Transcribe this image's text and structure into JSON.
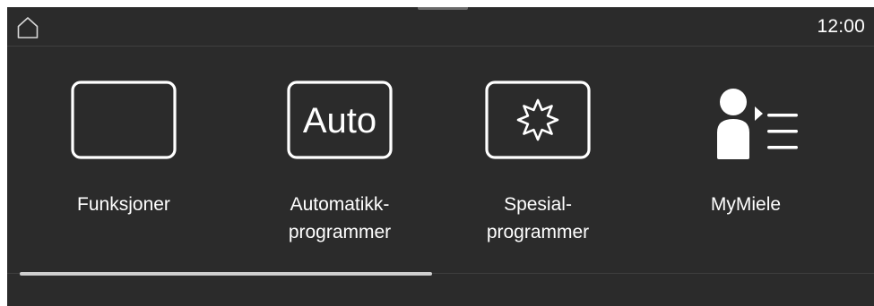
{
  "status_bar": {
    "home_icon": "home-icon",
    "time": "12:00"
  },
  "tiles": [
    {
      "label": "Funksjoner",
      "icon": "functions-frame-icon"
    },
    {
      "label": "Automatikk-\nprogrammer",
      "icon": "auto-icon",
      "icon_text": "Auto"
    },
    {
      "label": "Spesial-\nprogrammer",
      "icon": "special-star-icon"
    },
    {
      "label": "MyMiele",
      "icon": "mymiele-person-list-icon"
    }
  ],
  "scroll": {
    "position_fraction": 0.0,
    "visible_fraction": 0.49
  },
  "colors": {
    "background": "#2b2b2b",
    "foreground": "#ffffff",
    "divider": "#3f3f3f",
    "scroll_thumb": "#cfcfcf"
  }
}
